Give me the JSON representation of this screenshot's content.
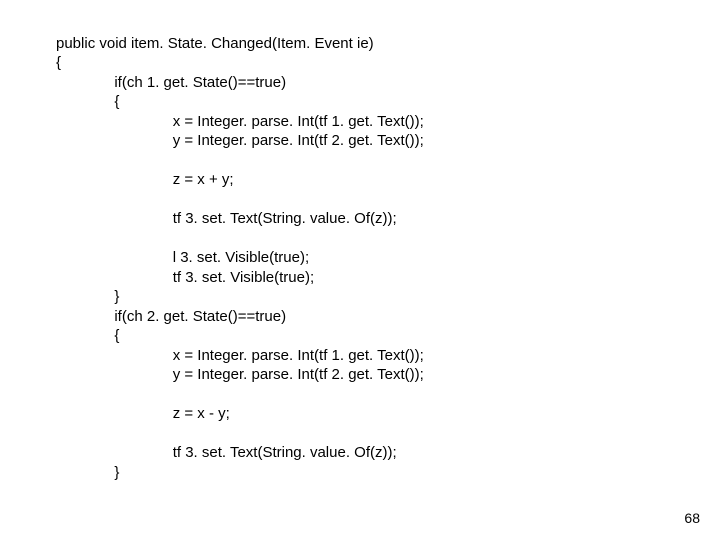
{
  "code": {
    "l1": "public void item. State. Changed(Item. Event ie)",
    "l2": "{",
    "l3": "              if(ch 1. get. State()==true)",
    "l4": "              {",
    "l5": "                            x = Integer. parse. Int(tf 1. get. Text());",
    "l6": "                            y = Integer. parse. Int(tf 2. get. Text());",
    "l7": "",
    "l8": "                            z = x + y;",
    "l9": "",
    "l10": "                            tf 3. set. Text(String. value. Of(z));",
    "l11": "",
    "l12": "                            l 3. set. Visible(true);",
    "l13": "                            tf 3. set. Visible(true);",
    "l14": "              }",
    "l15": "              if(ch 2. get. State()==true)",
    "l16": "              {",
    "l17": "                            x = Integer. parse. Int(tf 1. get. Text());",
    "l18": "                            y = Integer. parse. Int(tf 2. get. Text());",
    "l19": "",
    "l20": "                            z = x - y;",
    "l21": "",
    "l22": "                            tf 3. set. Text(String. value. Of(z));",
    "l23": "              }"
  },
  "page_number": "68"
}
